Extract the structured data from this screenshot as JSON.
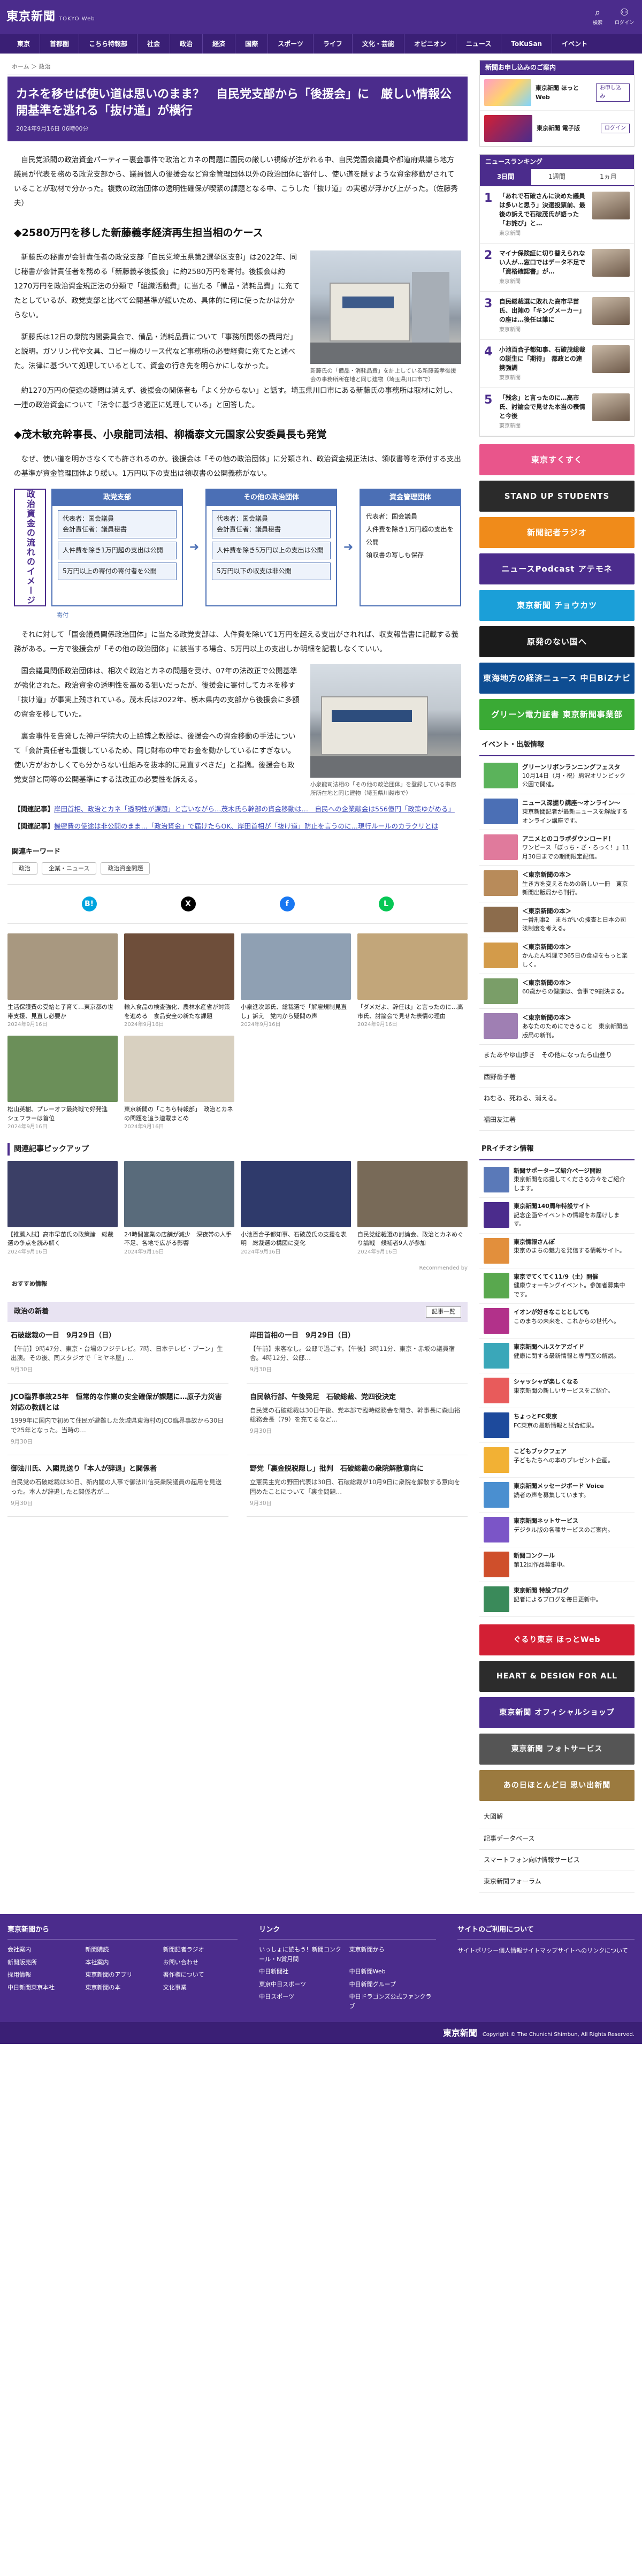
{
  "header": {
    "logo": "東京新聞",
    "logo_sub": "TOKYO Web",
    "icons": [
      {
        "name": "search-icon",
        "glyph": "⌕",
        "label": "検索"
      },
      {
        "name": "login-icon",
        "glyph": "⚇",
        "label": "ログイン"
      }
    ]
  },
  "nav": [
    "東京",
    "首都圏",
    "こちら特報部",
    "社会",
    "政治",
    "経済",
    "国際",
    "スポーツ",
    "ライフ",
    "文化・芸能",
    "オピニオン",
    "ニュース",
    "ToKuSan",
    "イベント"
  ],
  "breadcrumb": "ホーム ＞ 政治",
  "article": {
    "title": "カネを移せば使い道は思いのまま？　自民党支部から「後援会」に　厳しい情報公開基準を逃れる「抜け道」が横行",
    "date": "2024年9月16日 06時00分",
    "lead": "自民党派閥の政治資金パーティー裏金事件で政治とカネの問題に国民の厳しい視線が注がれる中、自民党国会議員や都道府県議ら地方議員が代表を務める政党支部から、議員個人の後援会など資金管理団体以外の政治団体に寄付し、使い道を隠すような資金移動がされていることが取材で分かった。複数の政治団体の透明性確保が喫緊の課題となる中、こうした「抜け道」の実態が浮かび上がった。（佐藤秀夫）",
    "h2_1": "◆2580万円を移した新藤義孝経済再生担当相のケース",
    "p1": "新藤氏の秘書が会計責任者の政党支部「自民党埼玉県第2選挙区支部」は2022年、同じ秘書が会計責任者を務める「新藤義孝後援会」に約2580万円を寄付。後援会は約1270万円を政治資金規正法の分類で「組織活動費」に当たる「備品・消耗品費」に充てたとしているが、政党支部と比べて公開基準が緩いため、具体的に何に使ったかは分からない。",
    "p2": "新藤氏は12日の衆院内閣委員会で、備品・消耗品費について「事務所関係の費用だ」と説明。ガソリン代や文具、コピー機のリース代など事務所の必要経費に充てたと述べた。法律に基づいて処理しているとして、資金の行き先を明らかにしなかった。",
    "p3": "約1270万円の使途の疑問は消えず、後援会の関係者も「よく分からない」と話す。埼玉県川口市にある新藤氏の事務所は取材に対し、一連の政治資金について「法令に基づき適正に処理している」と回答した。",
    "photo1_caption": "新藤氏の「備品・消耗品費」を計上している新藤義孝後援会の事務所所在地と同じ建物（埼玉県川口市で）",
    "h2_2": "◆茂木敏充幹事長、小泉龍司法相、柳橋泰文元国家公安委員長も発覚",
    "p4": "なぜ、使い道を明かさなくても許されるのか。後援会は「その他の政治団体」に分類され、政治資金規正法は、領収書等を添付する支出の基準が資金管理団体より緩い。1万円以下の支出は領収書の公開義務がない。",
    "diagram": {
      "side_label": "政治資金の流れのイメージ",
      "left": {
        "title": "政党支部",
        "box1": "代表者：国会議員\n会計責任者：議員秘書",
        "box2": "人件費を除き1万円超の支出は公開",
        "box3": "5万円以上の寄付の寄付者を公開"
      },
      "mid": {
        "title": "その他の政治団体",
        "box1": "代表者：国会議員\n会計責任者：議員秘書",
        "box2": "人件費を除き5万円以上の支出は公開",
        "box3": "5万円以下の収支は非公開"
      },
      "right": {
        "title": "資金管理団体",
        "body": "代表者：国会議員\n人件費を除き1万円超の支出を公開\n領収書の写しも保存"
      },
      "arrow_label": "寄付"
    },
    "p5": "それに対して「国会議員関係政治団体」に当たる政党支部は、人件費を除いて1万円を超える支出がされれば、収支報告書に記載する義務がある。一方で後援会が「その他の政治団体」に該当する場合、5万円以上の支出しか明細を記載しなくていい。",
    "p6": "国会議員関係政治団体は、相次ぐ政治とカネの問題を受け、07年の法改正で公開基準が強化された。政治資金の透明性を高める狙いだったが、後援会に寄付してカネを移す「抜け道」が事実上残されている。茂木氏は2022年、栃木県内の支部から後援会に多額の資金を移していた。",
    "p7": "裏金事件を告発した神戸学院大の上脇博之教授は、後援会への資金移動の手法について「会計責任者も重複しているため、同じ財布の中でお金を動かしているにすぎない。使い方がおかしくても分からない仕組みを抜本的に見直すべきだ」と指摘。後援会も政党支部と同等の公開基準にする法改正の必要性を訴える。",
    "photo2_caption": "小泉龍司法相の「その他の政治団体」を登録している事務所所在地と同じ建物（埼玉県川越市で）",
    "related": [
      {
        "label": "【関連記事】",
        "text": "岸田首相、政治とカネ「透明性が課題」と言いながら…茂木氏ら幹部の資金移動は…　自民への企業献金は556億円「政策ゆがめる」"
      },
      {
        "label": "【関連記事】",
        "text": "機密費の使途は非公開のまま…「政治資金」で届けたらOK、岸田首相が「抜け道」防止を言うのに…現行ルールのカラクリとは"
      }
    ]
  },
  "keywords": {
    "title": "関連キーワード",
    "tags": [
      "政治",
      "企業・ニュース",
      "政治資金問題"
    ]
  },
  "share": [
    {
      "name": "hatena-share-icon",
      "glyph": "B!",
      "color": "#00a4de"
    },
    {
      "name": "x-share-icon",
      "glyph": "X",
      "color": "#000000"
    },
    {
      "name": "facebook-share-icon",
      "glyph": "f",
      "color": "#1877f2"
    },
    {
      "name": "line-share-icon",
      "glyph": "L",
      "color": "#06c755"
    }
  ],
  "cards": [
    {
      "title": "生活保護費の受給と子育て…東京都の世帯支援、見直し必要か",
      "date": "2024年9月16日",
      "color": "#a89880"
    },
    {
      "title": "輸入食品の検査強化、農林水産省が対策を進める　食品安全の新たな課題",
      "date": "2024年9月16日",
      "color": "#6e4e3a"
    },
    {
      "title": "小泉進次郎氏、総裁選で「解雇規制見直し」訴え　党内から疑問の声",
      "date": "2024年9月16日",
      "color": "#8fa0b3"
    },
    {
      "title": "「ダメだよ、辞任は」と言ったのに…高市氏、討論会で見せた表情の理由",
      "date": "2024年9月16日",
      "color": "#c2a67a"
    },
    {
      "title": "松山英樹、プレーオフ最終戦で好発進　シェフラーは首位",
      "date": "2024年9月16日",
      "color": "#6b8f59"
    },
    {
      "title": "東京新聞の「こちら特報部」　政治とカネの問題を追う連載まとめ",
      "date": "2024年9月16日",
      "color": "#d8d0c0"
    }
  ],
  "pickup": {
    "title": "関連記事ピックアップ",
    "cards": [
      {
        "title": "【推薦入試】高市早苗氏の政策論　総裁選の争点を読み解く",
        "date": "2024年9月16日",
        "color": "#3b3f66"
      },
      {
        "title": "24時間営業の店舗が減少　深夜帯の人手不足、各地で広がる影響",
        "date": "2024年9月16日",
        "color": "#596b7b"
      },
      {
        "title": "小池百合子都知事、石破茂氏の支援を表明　総裁選の構図に変化",
        "date": "2024年9月16日",
        "color": "#2f3a6b"
      },
      {
        "title": "自民党総裁選の討論会、政治とカネめぐり論戦　候補者9人が参加",
        "date": "2024年9月16日",
        "color": "#786a58"
      }
    ],
    "sponsor": "Recommended by"
  },
  "recommend_label": "おすすめ情報",
  "politics_news": {
    "title": "政治の新着",
    "more": "記事一覧",
    "items": [
      {
        "title": "石破総裁の一日　9月29日（日）",
        "summary": "【午前】9時47分、東京・台場のフジテレビ。7時、日本テレビ・ブーン」生出演。その後、同スタジオで「ミヤネ屋」…",
        "date": "9月30日"
      },
      {
        "title": "岸田首相の一日　9月29日（日）",
        "summary": "【午前】来客なし。公邸で過ごす。【午後】3時11分、東京・赤坂の議員宿舎。4時12分、公邸…",
        "date": "9月30日"
      },
      {
        "title": "JCO臨界事故25年　恒常的な作業の安全確保が課題に…原子力災害対応の教訓とは",
        "summary": "1999年に国内で初めて住民が避難した茨城県東海村のJCO臨界事故から30日で25年となった。当時の…",
        "date": "9月30日"
      },
      {
        "title": "自民執行部、午後発足　石破総裁、党四役決定",
        "summary": "自民党の石破総裁は30日午後、党本部で臨時総務会を開き、幹事長に森山裕総務会長（79）を充てるなど…",
        "date": "9月30日"
      },
      {
        "title": "御法川氏、入閣見送り「本人が辞退」と関係者",
        "summary": "自民党の石破総裁は30日、新内閣の人事で御法川信英衆院議員の起用を見送った。本人が辞退したと関係者が…",
        "date": "9月30日"
      },
      {
        "title": "野党「裏金脱税隠し」批判　石破総裁の衆院解散意向に",
        "summary": "立憲民主党の野田代表は30日、石破総裁が10月9日に衆院を解散する意向を固めたことについて「裏金問題…",
        "date": "9月30日"
      }
    ]
  },
  "sidebar": {
    "promo_head": "新聞お申し込みのご案内",
    "promos": [
      {
        "text": "東京新聞 ほっとWeb",
        "btn": "お申し込み",
        "color": "#ff9ec3"
      },
      {
        "text": "東京新聞 電子版",
        "btn": "ログイン",
        "color": "#4b6fb5"
      }
    ],
    "ranking": {
      "title": "ニュースランキング",
      "tabs": [
        "3日間",
        "1週間",
        "1ヵ月"
      ],
      "items": [
        {
          "no": "1",
          "title": "「あれで石破さんに決めた議員は多いと思う」決選投票前、最後の訴えで石破茂氏が語った「お詫び」と…",
          "src": "東京新聞"
        },
        {
          "no": "2",
          "title": "マイナ保険証に切り替えられない人が…窓口ではデータ不足で「資格確認書」が…",
          "src": "東京新聞"
        },
        {
          "no": "3",
          "title": "自民総裁選に敗れた高市早苗氏、出陣の「キングメーカー」の座は…後任は誰に",
          "src": "東京新聞"
        },
        {
          "no": "4",
          "title": "小池百合子都知事、石破茂総裁の誕生に「期待」　都政との連携強調",
          "src": "東京新聞"
        },
        {
          "no": "5",
          "title": "「残念」と言ったのに…高市氏、討論会で見せた本当の表情と今後",
          "src": "東京新聞"
        }
      ]
    },
    "banners": [
      {
        "text": "東京すくすく",
        "color": "#e9558b"
      },
      {
        "text": "STAND UP STUDENTS",
        "color": "#2b2b2b"
      },
      {
        "text": "新聞記者ラジオ",
        "color": "#f08b1a"
      },
      {
        "text": "ニュースPodcast アテモネ",
        "color": "#4b2c8c"
      },
      {
        "text": "東京新聞 チョウカツ",
        "color": "#1b9fd8"
      },
      {
        "text": "原発のない国へ",
        "color": "#1a1a1a"
      },
      {
        "text": "東海地方の経済ニュース 中日BiZナビ",
        "color": "#0e4d92"
      },
      {
        "text": "グリーン電力証書 東京新聞事業部",
        "color": "#3aaa35"
      }
    ],
    "events_title": "イベント・出版情報",
    "events": [
      {
        "title": "グリーンリボンランニングフェスタ",
        "body": "10月14日（月・祝）駒沢オリンピック公園で開催。",
        "color": "#5bb35b"
      },
      {
        "title": "ニュース深掘り講座〜オンライン〜",
        "body": "東京新聞記者が最新ニュースを解説するオンライン講座です。",
        "color": "#4b6fb5"
      },
      {
        "title": "アニメとのコラボダウンロード！",
        "body": "ワンピース「ぼっち・ざ・ろっく！」11月30日までの期間限定配信。",
        "color": "#e07a9c"
      },
      {
        "title": "＜東京新聞の本＞",
        "body": "生き方を変えるための新しい一冊　東京新聞出版局から刊行。",
        "color": "#b88b5a"
      },
      {
        "title": "＜東京新聞の本＞",
        "body": "一番刑事2　まちがいの捜査と日本の司法制度を考える。",
        "color": "#8c6c4c"
      },
      {
        "title": "＜東京新聞の本＞",
        "body": "かんたん料理で365日の食卓をもっと楽しく。",
        "color": "#d39b4a"
      },
      {
        "title": "＜東京新聞の本＞",
        "body": "60歳からの健康は、食事で9割決まる。",
        "color": "#7a9e68"
      },
      {
        "title": "＜東京新聞の本＞",
        "body": "あなたのためにできること　東京新聞出版局の新刊。",
        "color": "#9f7fb3"
      }
    ],
    "accordions": [
      "またあやゆ山歩き　その他になったら山登り",
      "西野岳子著",
      "ねむる、死ねる、消える。",
      "福田友江著"
    ],
    "pr_title": "PRイチオシ情報",
    "prs": [
      {
        "title": "新聞サポーターズ紹介ページ開設",
        "body": "東京新聞を応援してくださる方々をご紹介します。",
        "color": "#5a79b8"
      },
      {
        "title": "東京新聞140周年特設サイト",
        "body": "記念企画やイベントの情報をお届けします。",
        "color": "#4b2c8c"
      },
      {
        "title": "東京情報さんぽ",
        "body": "東京のまちの魅力を発信する情報サイト。",
        "color": "#e28f3c"
      },
      {
        "title": "東京でてくてく11/9（土）開催",
        "body": "健康ウォーキングイベント。参加者募集中です。",
        "color": "#59a84e"
      },
      {
        "title": "イオンが好きなこととしても",
        "body": "このまちの未来を、これからの世代へ。",
        "color": "#b2318a"
      },
      {
        "title": "東京新聞ヘルスケアガイド",
        "body": "健康に関する最新情報と専門医の解説。",
        "color": "#3aa7b9"
      },
      {
        "title": "シャッシャが楽しくなる",
        "body": "東京新聞の新しいサービスをご紹介。",
        "color": "#e85b5b"
      },
      {
        "title": "ちょっとFC東京",
        "body": "FC東京の最新情報と試合結果。",
        "color": "#1d4a9c"
      },
      {
        "title": "こどもブックフェア",
        "body": "子どもたちへの本のプレゼント企画。",
        "color": "#f2b134"
      },
      {
        "title": "東京新聞メッセージボード Voice",
        "body": "読者の声を募集しています。",
        "color": "#4a8fd0"
      },
      {
        "title": "東京新聞ネットサービス",
        "body": "デジタル版の各種サービスのご案内。",
        "color": "#7b55c7"
      },
      {
        "title": "新聞コンクール",
        "body": "第12回作品募集中。",
        "color": "#cf4f2b"
      },
      {
        "title": "東京新聞 特設ブログ",
        "body": "記者によるブログを毎日更新中。",
        "color": "#3a8a5a"
      }
    ],
    "big_banners": [
      {
        "text": "ぐるり東京 ほっとWeb",
        "color": "#d31f34"
      },
      {
        "text": "HEART & DESIGN FOR ALL",
        "color": "#2c2c2c"
      },
      {
        "text": "東京新聞 オフィシャルショップ",
        "color": "#4b2c8c"
      },
      {
        "text": "東京新聞 フォトサービス",
        "color": "#555555"
      },
      {
        "text": "あの日ほとんど日 思い出新聞",
        "color": "#9b7a3f"
      }
    ],
    "links": [
      "大図解",
      "記事データベース",
      "スマートフォン向け情報サービス",
      "東京新聞フォーラム"
    ]
  },
  "footer": {
    "col1_title": "東京新聞から",
    "col1": [
      "会社案内",
      "新聞購読",
      "新聞記者ラジオ",
      "新聞販売所",
      "本社案内",
      "お問い合わせ",
      "採用情報",
      "東京新聞のアプリ",
      "著作権について",
      "中日新聞東京本社",
      "東京新聞の本",
      "文化事業"
    ],
    "col2_title": "リンク",
    "col2": [
      "いっしょに読もう！新聞コンクール・N賞月間",
      "東京新聞から",
      "中日新聞社",
      "中日新聞Web",
      "東京中日スポーツ",
      "中日新聞グループ",
      "中日スポーツ",
      "中日ドラゴンズ公式ファンクラブ"
    ],
    "col3_title": "サイトのご利用について",
    "col3": [
      "サイトポリシー",
      "個人情報",
      "サイトマップ",
      "サイトへのリンクについて"
    ],
    "copyright": "Copyright © The Chunichi Shimbun, All Rights Reserved.",
    "copy_logo": "東京新聞"
  }
}
